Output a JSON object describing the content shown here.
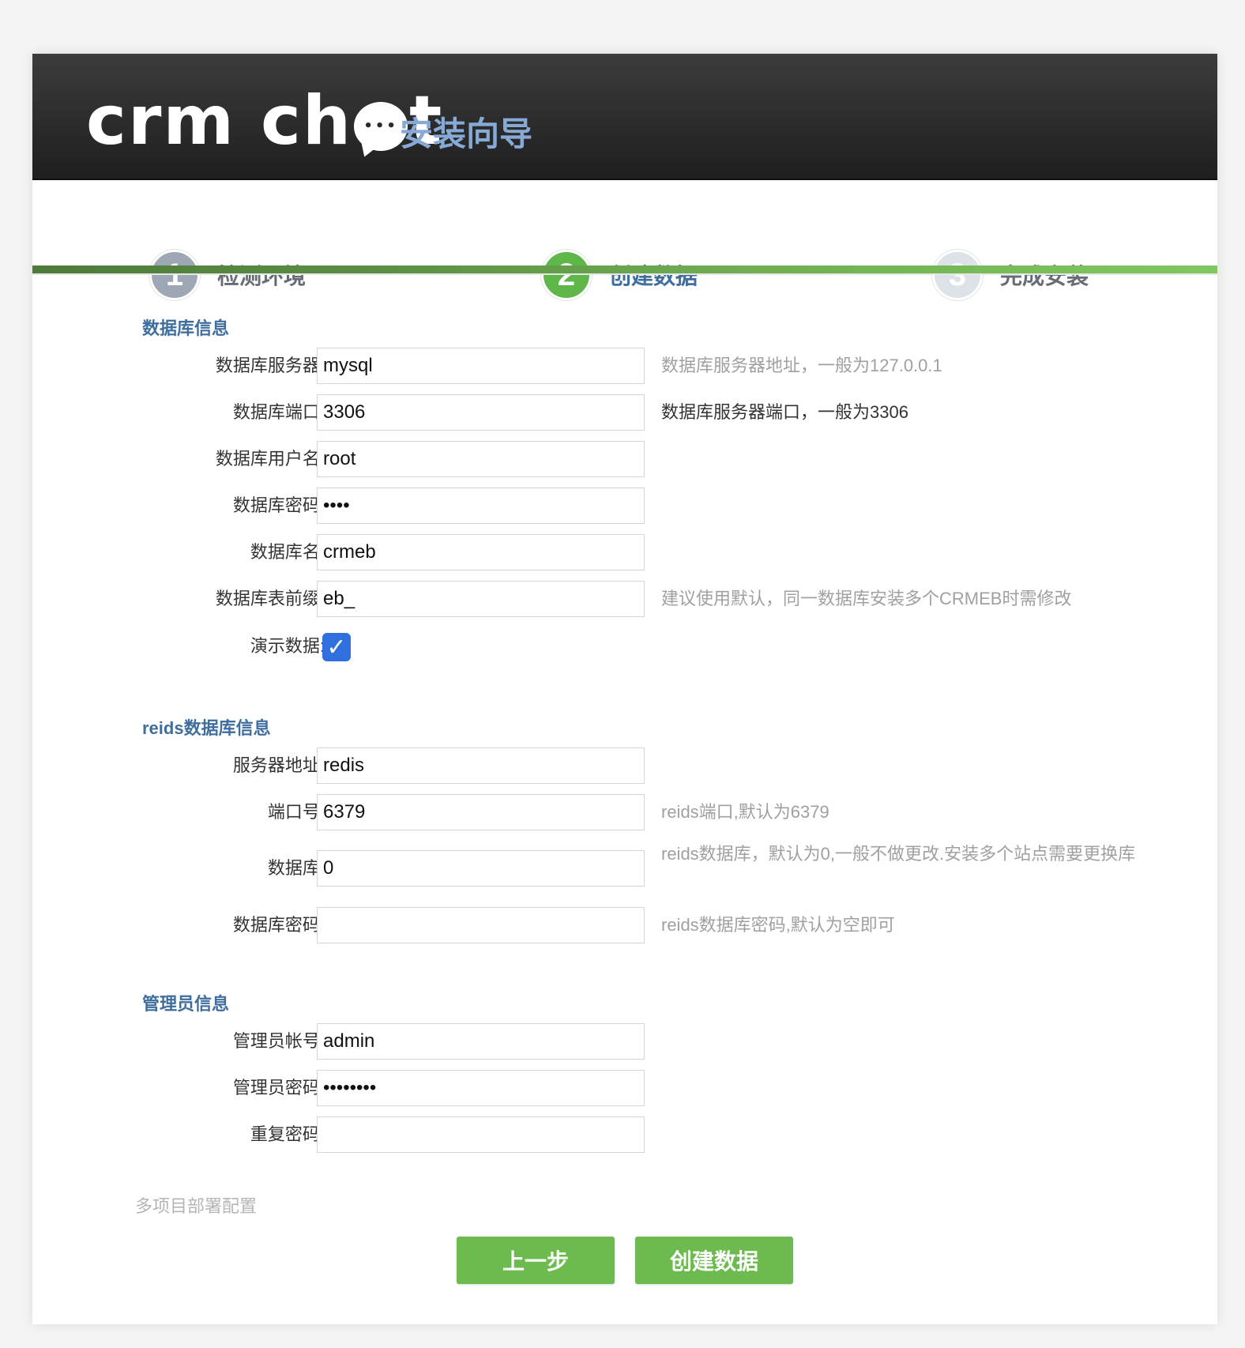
{
  "header": {
    "logo_text": "crm chat",
    "wizard_title": "安装向导"
  },
  "steps": [
    {
      "num": "1",
      "label": "检测环境"
    },
    {
      "num": "2",
      "label": "创建数据"
    },
    {
      "num": "3",
      "label": "完成安装"
    }
  ],
  "db": {
    "section_title": "数据库信息",
    "server": {
      "label": "数据库服务器:",
      "value": "mysql",
      "hint": "数据库服务器地址，一般为127.0.0.1"
    },
    "port": {
      "label": "数据库端口:",
      "value": "3306",
      "hint": "数据库服务器端口，一般为3306"
    },
    "user": {
      "label": "数据库用户名:",
      "value": "root"
    },
    "password": {
      "label": "数据库密码:",
      "value": "••••"
    },
    "name": {
      "label": "数据库名:",
      "value": "crmeb"
    },
    "prefix": {
      "label": "数据库表前缀:",
      "value": "eb_",
      "hint": "建议使用默认，同一数据库安装多个CRMEB时需修改"
    },
    "demo": {
      "label": "演示数据:",
      "checked": true
    }
  },
  "redis": {
    "section_title": "reids数据库信息",
    "server": {
      "label": "服务器地址:",
      "value": "redis"
    },
    "port": {
      "label": "端口号:",
      "value": "6379",
      "hint": "reids端口,默认为6379"
    },
    "db": {
      "label": "数据库:",
      "value": "0",
      "hint": "reids数据库，默认为0,一般不做更改.安装多个站点需要更换库"
    },
    "password": {
      "label": "数据库密码:",
      "value": "",
      "hint": "reids数据库密码,默认为空即可"
    }
  },
  "admin": {
    "section_title": "管理员信息",
    "account": {
      "label": "管理员帐号:",
      "value": "admin"
    },
    "password": {
      "label": "管理员密码:",
      "value": "••••••••"
    },
    "repeat": {
      "label": "重复密码:",
      "value": ""
    }
  },
  "multi_deploy": "多项目部署配置",
  "buttons": {
    "prev": "上一步",
    "create": "创建数据"
  },
  "colors": {
    "accent_green": "#6dbb4f",
    "step_active": "#5fb74a",
    "title_blue": "#3f6e9e",
    "checkbox_blue": "#2f6fde"
  }
}
